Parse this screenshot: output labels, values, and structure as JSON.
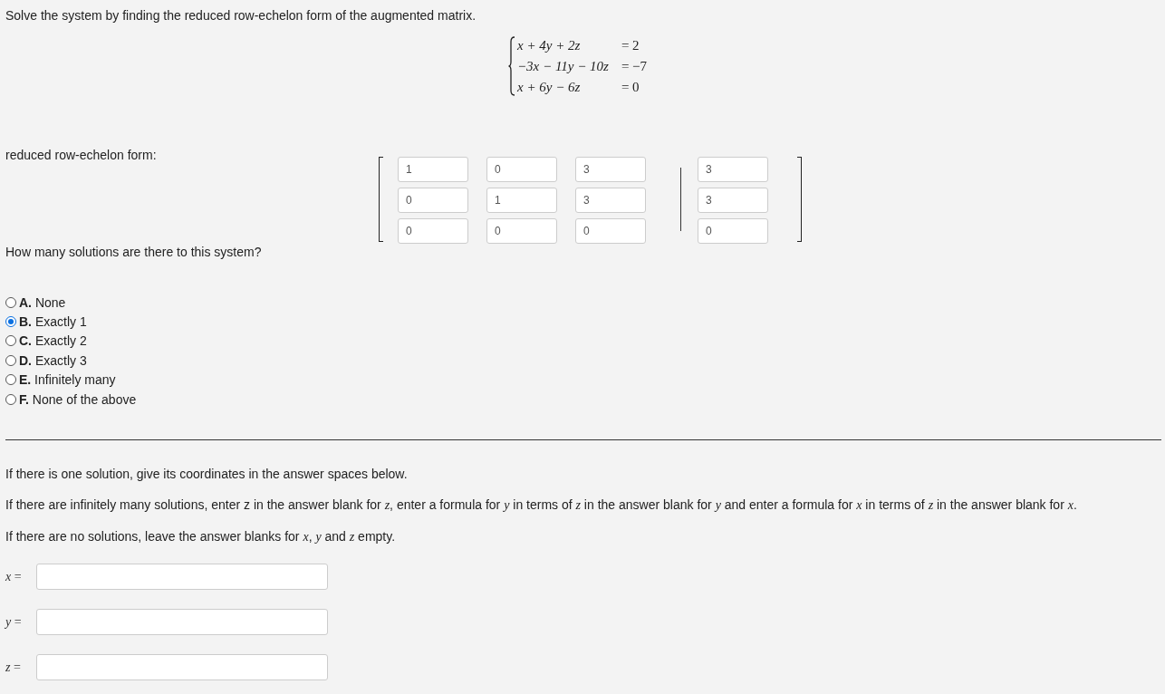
{
  "instruction": "Solve the system by finding the reduced row-echelon form of the augmented matrix.",
  "system": [
    {
      "lhs": "x + 4y + 2z",
      "rhs": "= 2"
    },
    {
      "lhs": "−3x − 11y − 10z",
      "rhs": "= −7"
    },
    {
      "lhs": "x + 6y − 6z",
      "rhs": "= 0"
    }
  ],
  "rref_label": "reduced row-echelon form:",
  "matrix": {
    "rows": [
      {
        "coefficients": [
          "1",
          "0",
          "3"
        ],
        "constant": "3"
      },
      {
        "coefficients": [
          "0",
          "1",
          "3"
        ],
        "constant": "3"
      },
      {
        "coefficients": [
          "0",
          "0",
          "0"
        ],
        "constant": "0"
      }
    ]
  },
  "question": "How many solutions are there to this system?",
  "options": [
    {
      "letter": "A.",
      "text": "None",
      "selected": false
    },
    {
      "letter": "B.",
      "text": "Exactly 1",
      "selected": true
    },
    {
      "letter": "C.",
      "text": "Exactly 2",
      "selected": false
    },
    {
      "letter": "D.",
      "text": "Exactly 3",
      "selected": false
    },
    {
      "letter": "E.",
      "text": "Infinitely many",
      "selected": false
    },
    {
      "letter": "F.",
      "text": "None of the above",
      "selected": false
    }
  ],
  "notes": [
    "If there is one solution, give its coordinates in the answer spaces below.",
    "If there are infinitely many solutions, enter z in the answer blank for *z*, enter a formula for *y* in terms of *z* in the answer blank for *y* and enter a formula for *x* in terms of *z* in the answer blank for *x*.",
    "If there are no solutions, leave the answer blanks for *x*, *y* and *z* empty."
  ],
  "answers": [
    {
      "label": "*x* ="
    },
    {
      "label": "*y* ="
    },
    {
      "label": "*z* ="
    }
  ]
}
